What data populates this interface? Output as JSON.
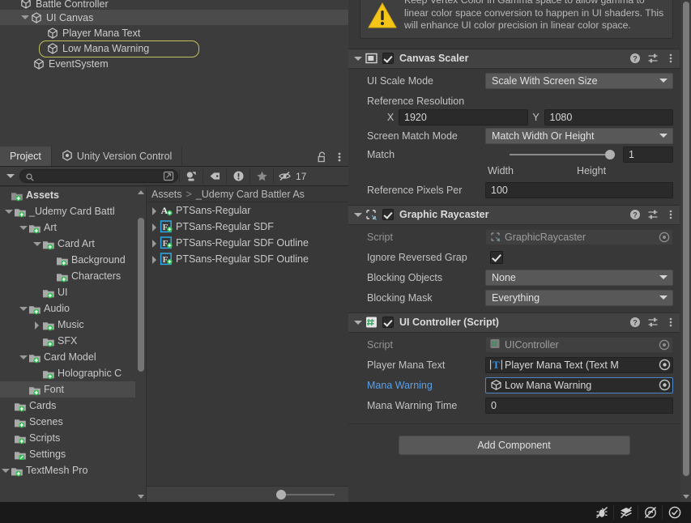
{
  "hierarchy": {
    "rows": [
      {
        "label": "Battle Controller",
        "indent": 20,
        "twisty": "none",
        "icon": "gameobject-icon",
        "state": "clipped"
      },
      {
        "label": "UI Canvas",
        "indent": 20,
        "twisty": "open",
        "icon": "gameobject-icon",
        "state": "hover"
      },
      {
        "label": "Player Mana Text",
        "indent": 53,
        "twisty": "none",
        "icon": "gameobject-icon",
        "state": "normal"
      },
      {
        "label": "Low Mana Warning",
        "indent": 53,
        "twisty": "none",
        "icon": "gameobject-icon",
        "state": "drop-target"
      },
      {
        "label": "EventSystem",
        "indent": 36,
        "twisty": "none",
        "icon": "gameobject-icon",
        "state": "normal"
      }
    ]
  },
  "project": {
    "tabs": [
      {
        "label": "Project",
        "icon": "none",
        "active": true
      },
      {
        "label": "Unity Version Control",
        "icon": "unity-vcs-icon",
        "active": false
      }
    ],
    "tab_lock_icon": "lock-open-icon",
    "tab_menu_icon": "kebab-menu-icon",
    "toolbar": {
      "create_dropdown_icon": "chevron-down-icon",
      "search_placeholder": "",
      "search_value": "",
      "search_icon": "search-icon",
      "expand_icon": "expand-window-icon",
      "filter_type_icon": "filter-by-type-icon",
      "filter_label_icon": "filter-by-label-icon",
      "filter_issue_icon": "filter-by-issue-icon",
      "filter_favorite_icon": "filter-by-favorite-icon",
      "hidden_icon": "eye-off-icon",
      "hidden_count": "17"
    },
    "tree": [
      {
        "label": "Assets",
        "indent": 4,
        "twisty": "none",
        "icon": "folder-assets-icon",
        "bold": true,
        "selected": false
      },
      {
        "label": "_Udemy Card Battl",
        "indent": 17,
        "twisty": "open",
        "icon": "folder-icon",
        "bold": false,
        "selected": false
      },
      {
        "label": "Art",
        "indent": 35,
        "twisty": "open",
        "icon": "folder-icon",
        "bold": false,
        "selected": false
      },
      {
        "label": "Card Art",
        "indent": 52,
        "twisty": "open",
        "icon": "folder-icon",
        "bold": false,
        "selected": false
      },
      {
        "label": "Background",
        "indent": 69,
        "twisty": "none",
        "icon": "folder-icon",
        "bold": false,
        "selected": false
      },
      {
        "label": "Characters",
        "indent": 69,
        "twisty": "none",
        "icon": "folder-icon",
        "bold": false,
        "selected": false
      },
      {
        "label": "UI",
        "indent": 52,
        "twisty": "none",
        "icon": "folder-icon",
        "bold": false,
        "selected": false
      },
      {
        "label": "Audio",
        "indent": 35,
        "twisty": "open",
        "icon": "folder-icon",
        "bold": false,
        "selected": false
      },
      {
        "label": "Music",
        "indent": 52,
        "twisty": "closed",
        "icon": "folder-icon",
        "bold": false,
        "selected": false
      },
      {
        "label": "SFX",
        "indent": 52,
        "twisty": "none",
        "icon": "folder-icon",
        "bold": false,
        "selected": false
      },
      {
        "label": "Card Model",
        "indent": 35,
        "twisty": "open",
        "icon": "folder-icon",
        "bold": false,
        "selected": false
      },
      {
        "label": "Holographic C",
        "indent": 52,
        "twisty": "none",
        "icon": "folder-icon",
        "bold": false,
        "selected": false
      },
      {
        "label": "Font",
        "indent": 35,
        "twisty": "none",
        "icon": "folder-icon",
        "bold": false,
        "selected": true
      },
      {
        "label": "Cards",
        "indent": 17,
        "twisty": "none",
        "icon": "folder-icon",
        "bold": false,
        "selected": false
      },
      {
        "label": "Scenes",
        "indent": 17,
        "twisty": "none",
        "icon": "folder-icon",
        "bold": false,
        "selected": false
      },
      {
        "label": "Scripts",
        "indent": 17,
        "twisty": "none",
        "icon": "folder-icon",
        "bold": false,
        "selected": false
      },
      {
        "label": "Settings",
        "indent": 17,
        "twisty": "none",
        "icon": "folder-settings-icon",
        "bold": false,
        "selected": false
      },
      {
        "label": "TextMesh Pro",
        "indent": 4,
        "twisty": "open",
        "icon": "folder-icon",
        "bold": false,
        "selected": false
      }
    ],
    "breadcrumb": {
      "root": "Assets",
      "separator": ">",
      "current": "_Udemy Card Battler As"
    },
    "assets": [
      {
        "label": "PTSans-Regular",
        "icon": "font-asset-icon",
        "selected": false
      },
      {
        "label": "PTSans-Regular SDF",
        "icon": "tmp-font-asset-icon",
        "selected": false
      },
      {
        "label": "PTSans-Regular SDF Outline",
        "icon": "tmp-font-asset-icon",
        "selected": false
      },
      {
        "label": "PTSans-Regular SDF Outline",
        "icon": "tmp-font-asset-icon",
        "selected": false
      }
    ]
  },
  "inspector": {
    "helpbox": {
      "icon": "warning-icon",
      "text": "Keep Vertex Color in Gamma space to allow gamma to linear color space conversion to happen in UI shaders. This will enhance UI color precision in linear color space."
    },
    "components": [
      {
        "title": "Canvas Scaler",
        "icon": "canvas-scaler-icon",
        "enabled": true,
        "expanded": true,
        "help_icon": "help-icon",
        "preset_icon": "preset-icon",
        "menu_icon": "kebab-menu-icon",
        "fields": [
          {
            "type": "dropdown",
            "label": "UI Scale Mode",
            "value": "Scale With Screen Size"
          },
          {
            "type": "section",
            "label": "Reference Resolution"
          },
          {
            "type": "xy",
            "x_label": "X",
            "x_value": "1920",
            "y_label": "Y",
            "y_value": "1080"
          },
          {
            "type": "dropdown",
            "label": "Screen Match Mode",
            "value": "Match Width Or Height"
          },
          {
            "type": "slider",
            "label": "Match",
            "value": "1",
            "min_label": "Width",
            "max_label": "Height",
            "fill": 1.0
          },
          {
            "type": "text",
            "label": "Reference Pixels Per",
            "value": "100"
          }
        ]
      },
      {
        "title": "Graphic Raycaster",
        "icon": "graphic-raycaster-icon",
        "enabled": true,
        "expanded": true,
        "help_icon": "help-icon",
        "preset_icon": "preset-icon",
        "menu_icon": "kebab-menu-icon",
        "fields": [
          {
            "type": "object-readonly",
            "label": "Script",
            "value": "GraphicRaycaster",
            "obj_icon": "script-raycaster-icon"
          },
          {
            "type": "checkbox",
            "label": "Ignore Reversed Grap",
            "checked": true
          },
          {
            "type": "dropdown",
            "label": "Blocking Objects",
            "value": "None"
          },
          {
            "type": "dropdown",
            "label": "Blocking Mask",
            "value": "Everything"
          }
        ]
      },
      {
        "title": "UI Controller (Script)",
        "icon": "cs-script-icon",
        "enabled": true,
        "expanded": true,
        "help_icon": "help-icon",
        "preset_icon": "preset-icon",
        "menu_icon": "kebab-menu-icon",
        "fields": [
          {
            "type": "object-readonly",
            "label": "Script",
            "value": "UIController",
            "obj_icon": "cs-script-small-icon"
          },
          {
            "type": "object",
            "label": "Player Mana Text",
            "value": "Player Mana Text (Text M",
            "obj_icon": "tmp-text-icon"
          },
          {
            "type": "object-highlight",
            "label": "Mana Warning",
            "value": "Low Mana Warning",
            "obj_icon": "gameobject-icon",
            "label_style": "link"
          },
          {
            "type": "text",
            "label": "Mana Warning Time",
            "value": "0"
          }
        ]
      }
    ],
    "add_component_label": "Add Component"
  },
  "statusbar": {
    "icons": [
      {
        "name": "debug-off-icon"
      },
      {
        "name": "layers-off-icon"
      },
      {
        "name": "collab-off-icon"
      },
      {
        "name": "check-circle-icon"
      }
    ]
  },
  "colors": {
    "panel_bg": "#383838",
    "panel_alt_bg": "#3c3c3c",
    "header_bg": "#424242",
    "selection": "#4b4b4b",
    "drop_outline": "#c2c05c",
    "link_blue": "#5b9fe8",
    "field_border_blue": "#4a86c8",
    "warning_yellow": "#f1c40f",
    "green_badge": "#25c04a",
    "statusbar_bg": "#191919"
  }
}
